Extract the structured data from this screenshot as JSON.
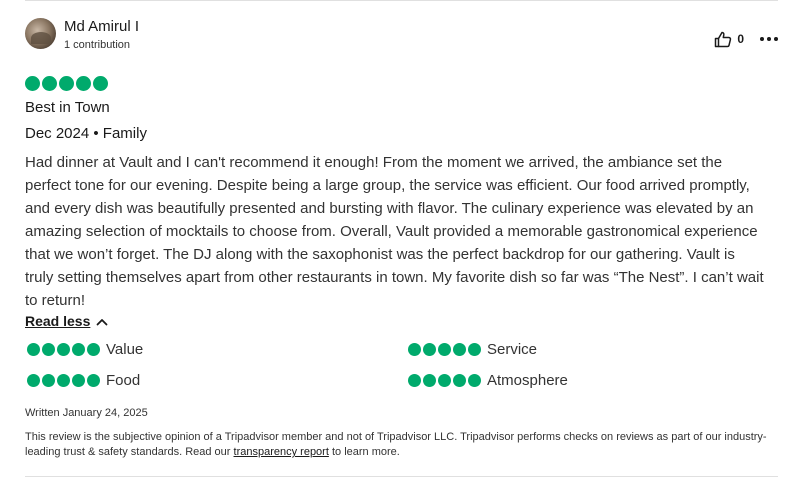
{
  "user": {
    "name": "Md Amirul I",
    "contributions": "1 contribution"
  },
  "actions": {
    "like_count": "0",
    "like_icon": "thumbs-up-icon",
    "more_icon": "more-options-icon"
  },
  "review": {
    "rating": 5,
    "rating_max": 5,
    "title": "Best in Town",
    "meta": "Dec 2024 • Family",
    "body": "Had dinner at Vault and I can't recommend it enough! From the moment we arrived, the ambiance set the perfect tone for our evening. Despite being a large group, the service was efficient. Our food arrived promptly, and every dish was beautifully presented and bursting with flavor. The culinary experience was elevated by an amazing selection of mocktails to choose from. Overall, Vault provided a memorable gastronomical experience that we won’t forget. The DJ along with the saxophonist was the perfect backdrop for our gathering. Vault is truly setting themselves apart from other restaurants in town. My favorite dish so far was “The Nest”. I can’t wait to return!",
    "read_less_label": "Read less"
  },
  "sub_ratings": [
    {
      "label": "Value",
      "rating": 5
    },
    {
      "label": "Service",
      "rating": 5
    },
    {
      "label": "Food",
      "rating": 5
    },
    {
      "label": "Atmosphere",
      "rating": 5
    }
  ],
  "footer": {
    "written": "Written January 24, 2025",
    "disclaimer_before": "This review is the subjective opinion of a Tripadvisor member and not of Tripadvisor LLC. Tripadvisor performs checks on reviews as part of our industry-leading trust & safety standards. Read our ",
    "disclaimer_link": "transparency report",
    "disclaimer_after": " to learn more."
  },
  "colors": {
    "bubble": "#00aa6c",
    "text": "#1a1a1a"
  }
}
